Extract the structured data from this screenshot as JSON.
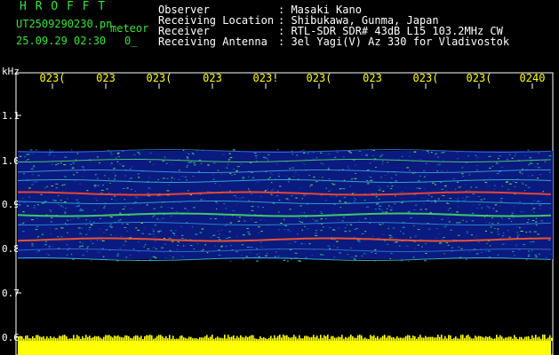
{
  "header": {
    "brand": "H R O F F T",
    "file": "UT2509290230.pn",
    "meteor": "meteor",
    "datetime": "25.09.29 02:30",
    "count": "0_",
    "info": [
      {
        "label": "Observer",
        "value": ": Masaki Kano"
      },
      {
        "label": "Receiving Location",
        "value": ": Shibukawa, Gunma, Japan"
      },
      {
        "label": "Receiver",
        "value": ": RTL-SDR SDR# 43dB L15 103.2MHz CW"
      },
      {
        "label": "Receiving Antenna",
        "value": ": 3el Yagi(V) Az 330 for Vladivostok"
      }
    ]
  },
  "axes": {
    "y_unit": "kHz",
    "x_ticks": [
      "023(",
      "023",
      "023(",
      "023",
      "023!",
      "023(",
      "023",
      "023(",
      "023(",
      "0240"
    ],
    "y_ticks": [
      "1.1",
      "1.0",
      "0.9",
      "0.8",
      "0.7",
      "0.6"
    ]
  },
  "colors": {
    "background": "#000000",
    "grid": "#ffffff",
    "tick_text": "#ffff00",
    "header_green": "#35e635",
    "header_white": "#ffffff",
    "signal_yellow": "#ffff00"
  }
}
